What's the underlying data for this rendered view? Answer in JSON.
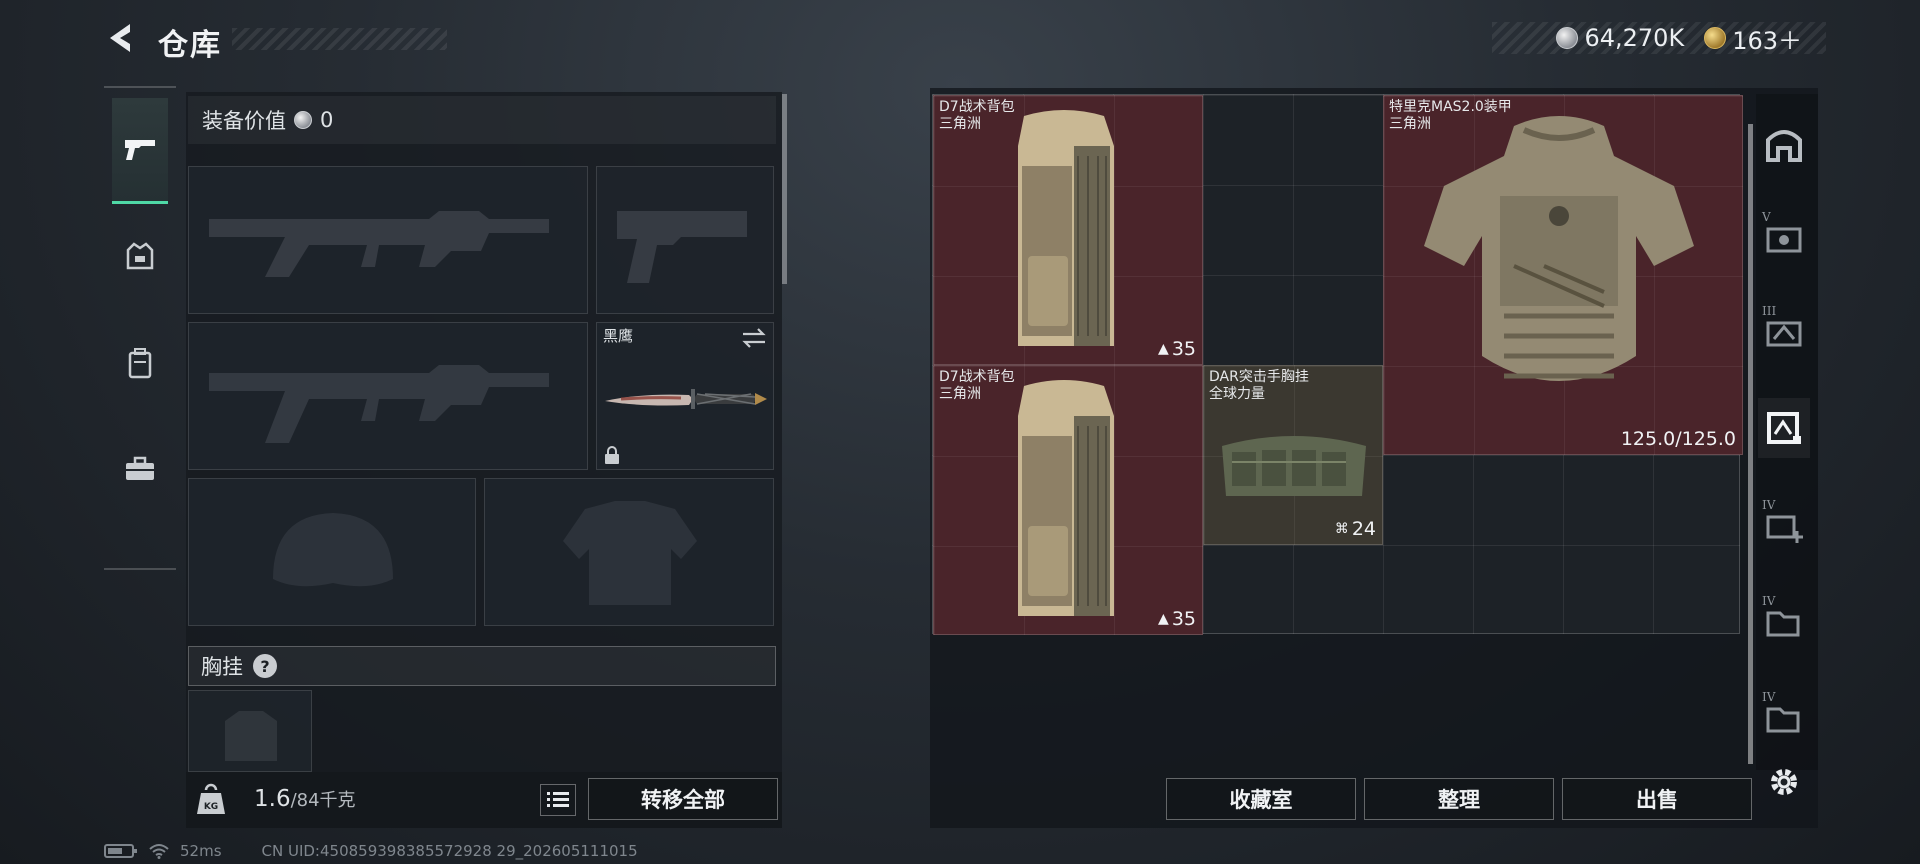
{
  "header": {
    "title": "仓库",
    "currencies": [
      {
        "icon": "silver-coin-icon",
        "value": "64,270K"
      },
      {
        "icon": "gold-coin-icon",
        "value": "163＋"
      }
    ]
  },
  "equipment": {
    "value_label": "装备价值",
    "value": "0",
    "knife_name": "黑鹰",
    "chest_rig_label": "胸挂",
    "help_mark": "?"
  },
  "bottom_left": {
    "weight_current": "1.6",
    "weight_max": "/84千克",
    "transfer_all_label": "转移全部"
  },
  "stash": {
    "items": [
      {
        "name": "D7战术背包",
        "brand": "三角洲",
        "count": "35",
        "count_icon": "backpack-icon"
      },
      {
        "name": "D7战术背包",
        "brand": "三角洲",
        "count": "35",
        "count_icon": "backpack-icon"
      },
      {
        "name": "DAR突击手胸挂",
        "brand": "全球力量",
        "count": "24",
        "count_icon": "rig-icon"
      },
      {
        "name": "特里克MAS2.0装甲",
        "brand": "三角洲",
        "durability": "125.0/125.0"
      }
    ],
    "side_tiers": [
      "V",
      "III",
      "IV",
      "IV",
      "IV"
    ]
  },
  "actions": {
    "collection_label": "收藏室",
    "organize_label": "整理",
    "sell_label": "出售"
  },
  "status": {
    "ping": "52ms",
    "uid": "CN UID:450859398385572928 29_202605111015"
  },
  "colors": {
    "accent": "#4fd8a6",
    "item_red": "#4a242a",
    "item_tan": "#3b3830"
  }
}
